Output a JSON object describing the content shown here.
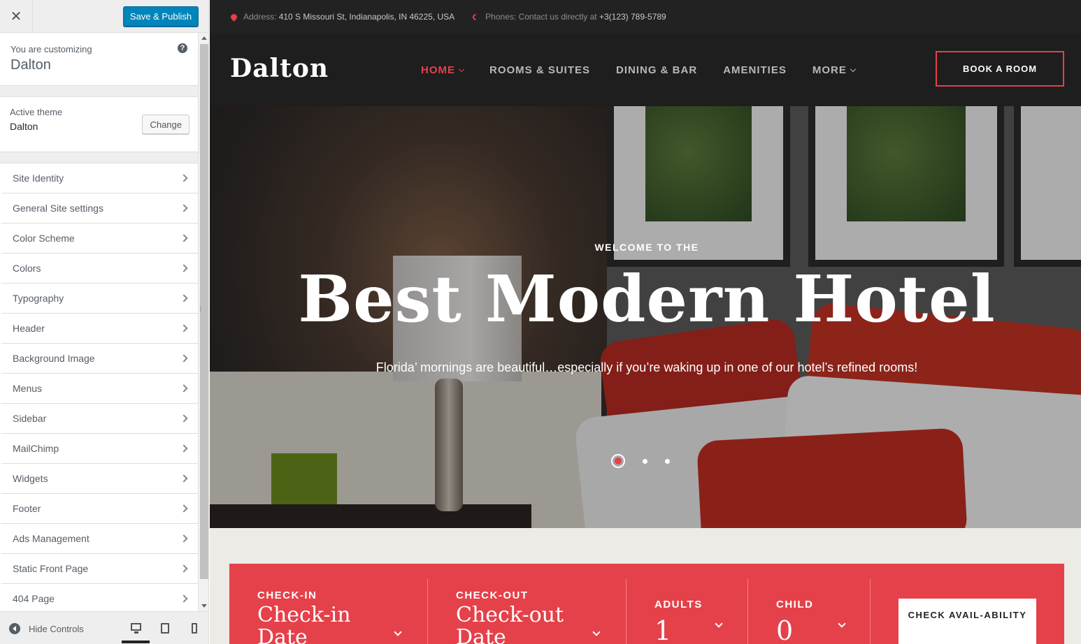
{
  "customizer": {
    "close_glyph": "✕",
    "save_label": "Save & Publish",
    "customizing_label": "You are customizing",
    "site_name": "Dalton",
    "help_glyph": "?",
    "active_theme_label": "Active theme",
    "active_theme_name": "Dalton",
    "change_label": "Change",
    "sections": [
      {
        "label": "Site Identity"
      },
      {
        "label": "General Site settings"
      },
      {
        "label": "Color Scheme"
      },
      {
        "label": "Colors"
      },
      {
        "label": "Typography"
      },
      {
        "label": "Header"
      },
      {
        "label": "Background Image"
      },
      {
        "label": "Menus"
      },
      {
        "label": "Sidebar"
      },
      {
        "label": "MailChimp"
      },
      {
        "label": "Widgets"
      },
      {
        "label": "Footer"
      },
      {
        "label": "Ads Management"
      },
      {
        "label": "Static Front Page"
      },
      {
        "label": "404 Page"
      }
    ],
    "hide_controls_label": "Hide Controls",
    "devices": [
      "desktop-icon",
      "tablet-icon",
      "mobile-icon"
    ],
    "active_device": "desktop"
  },
  "site": {
    "topbar": {
      "address_label": "Address:",
      "address_value": "410 S Missouri St, Indianapolis, IN 46225, USA",
      "phones_label": "Phones:",
      "phones_text": "Contact us directly at",
      "phones_value": "+3(123) 789-5789"
    },
    "logo": "Dalton",
    "nav": [
      {
        "label": "HOME",
        "active": true,
        "has_caret": true
      },
      {
        "label": "ROOMS & SUITES",
        "active": false,
        "has_caret": false
      },
      {
        "label": "DINING & BAR",
        "active": false,
        "has_caret": false
      },
      {
        "label": "AMENITIES",
        "active": false,
        "has_caret": false
      },
      {
        "label": "MORE",
        "active": false,
        "has_caret": true
      }
    ],
    "book_label": "BOOK A ROOM",
    "hero": {
      "welcome": "WELCOME TO THE",
      "title": "Best Modern Hotel",
      "subtitle": "Florida’ mornings are beautiful…especially if you’re waking up in one of our hotel’s refined rooms!",
      "slides": 3,
      "active_slide": 1
    },
    "booking": {
      "checkin_label": "CHECK-IN",
      "checkin_value": "Check-in Date",
      "checkout_label": "CHECK-OUT",
      "checkout_value": "Check-out Date",
      "adults_label": "ADULTS",
      "adults_value": "1",
      "child_label": "CHILD",
      "child_value": "0",
      "check_label": "CHECK AVAIL-ABILITY"
    },
    "colors": {
      "accent": "#e5414a",
      "topbar_bg": "#222222",
      "header_bg": "#1e1e1e",
      "button_blue": "#0085ba"
    }
  }
}
